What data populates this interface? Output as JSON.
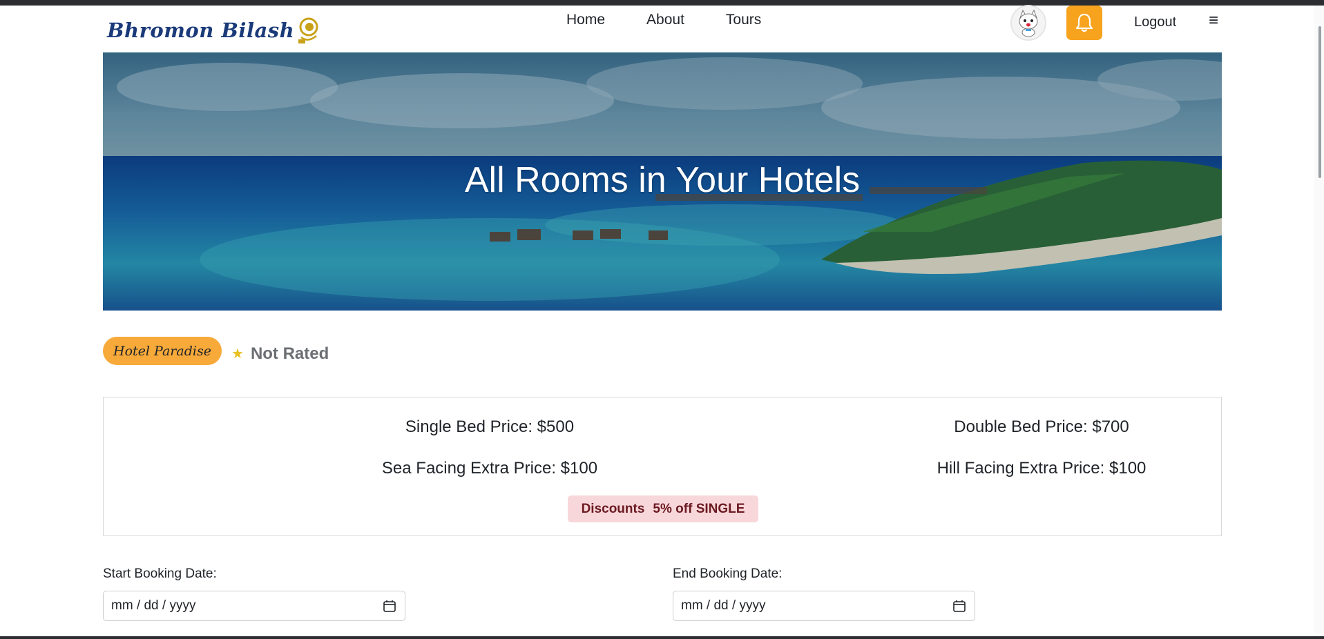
{
  "brand": {
    "logo_text": "Bhromon Bilash"
  },
  "nav": {
    "home": "Home",
    "about": "About",
    "tours": "Tours"
  },
  "header": {
    "logout_label": "Logout",
    "menu_icon": "≡"
  },
  "hero": {
    "title": "All Rooms in Your Hotels"
  },
  "hotel": {
    "name": "Hotel Paradise",
    "rating_text": "Not Rated"
  },
  "prices": {
    "single": "Single Bed Price: $500",
    "double": "Double Bed Price: $700",
    "sea": "Sea Facing Extra Price: $100",
    "hill": "Hill Facing Extra Price: $100"
  },
  "discount": {
    "label": "Discounts",
    "value": "5% off SINGLE"
  },
  "booking": {
    "start_label": "Start Booking Date:",
    "end_label": "End Booking Date:",
    "start_placeholder": "mm / dd / yyyy",
    "end_placeholder": "mm / dd / yyyy"
  },
  "colors": {
    "accent_orange": "#f7a31d",
    "badge_orange": "#f7a93a",
    "discount_bg": "#f8d7da",
    "discount_text": "#6b1a21",
    "logo_blue": "#1b3a7a"
  },
  "icons": {
    "bell": "bell-icon",
    "calendar": "calendar-icon",
    "star": "star-icon",
    "menu": "hamburger-icon"
  }
}
